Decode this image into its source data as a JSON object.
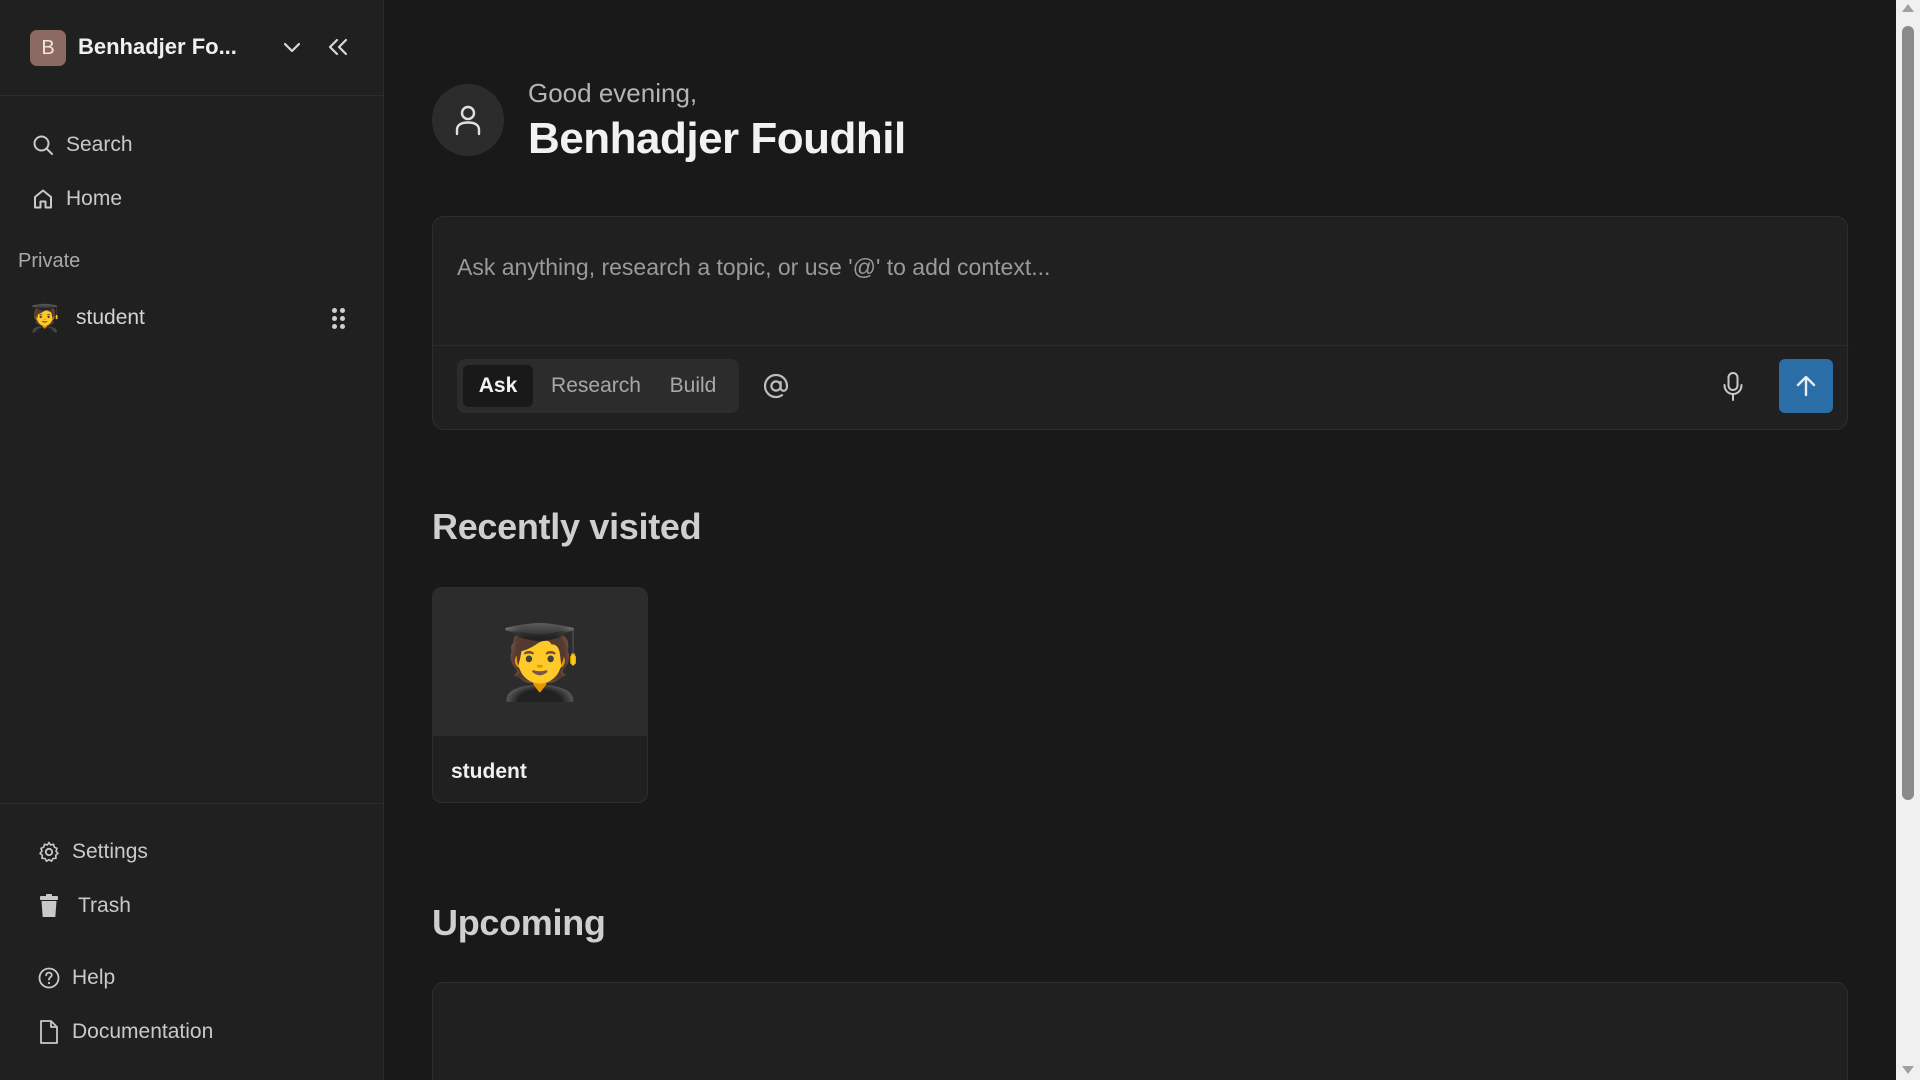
{
  "sidebar": {
    "workspace": {
      "initial": "B",
      "name": "Benhadjer Fo..."
    },
    "nav": [
      {
        "label": "Search",
        "icon": "search-icon"
      },
      {
        "label": "Home",
        "icon": "home-icon"
      }
    ],
    "section_label": "Private",
    "pages": [
      {
        "emoji": "🧑‍🎓",
        "label": "student"
      }
    ],
    "bottom": [
      {
        "label": "Settings",
        "icon": "gear-icon"
      },
      {
        "label": "Trash",
        "icon": "trash-icon"
      },
      {
        "label": "Help",
        "icon": "help-icon"
      },
      {
        "label": "Documentation",
        "icon": "document-icon"
      }
    ]
  },
  "main": {
    "greeting": "Good evening,",
    "user_name": "Benhadjer Foudhil",
    "composer": {
      "placeholder": "Ask anything, research a topic, or use '@' to add context...",
      "modes": [
        "Ask",
        "Research",
        "Build"
      ],
      "active_mode": "Ask"
    },
    "recently_visited": {
      "heading": "Recently visited",
      "cards": [
        {
          "emoji": "🧑‍🎓",
          "title": "student"
        }
      ]
    },
    "upcoming": {
      "heading": "Upcoming"
    }
  },
  "colors": {
    "background": "#191919",
    "sidebar": "#202020",
    "accent": "#2b6da6",
    "workspace_avatar": "#8a6a63"
  }
}
